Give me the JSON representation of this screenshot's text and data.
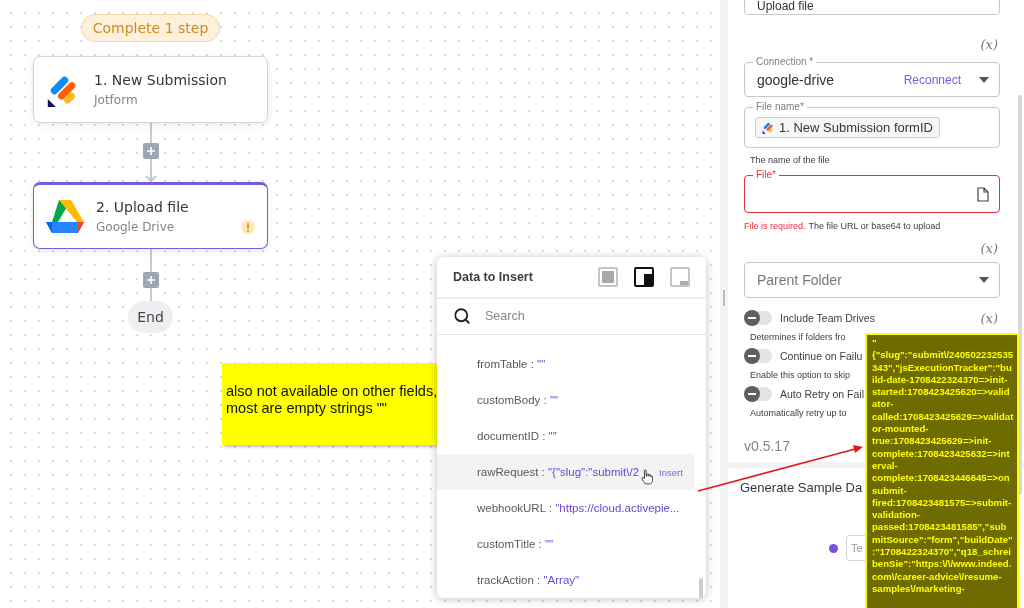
{
  "flow": {
    "status_badge": "Complete 1 step",
    "steps": [
      {
        "kind": "jotform",
        "title": "1. New Submission",
        "app": "Jotform",
        "selected": false,
        "warning": false
      },
      {
        "kind": "drive",
        "title": "2. Upload file",
        "app": "Google Drive",
        "selected": true,
        "warning": true
      }
    ],
    "end_label": "End"
  },
  "note": {
    "text": "also not available on other fields, most are empty strings \"\""
  },
  "data_popup": {
    "title": "Data to Insert",
    "view_buttons": [
      {
        "kind": "full",
        "selected": false
      },
      {
        "kind": "dock",
        "selected": true
      },
      {
        "kind": "mini",
        "selected": false
      }
    ],
    "search": {
      "placeholder": "Search"
    },
    "items": [
      {
        "key": "fromTable :",
        "value": "\"\"",
        "hovered": false
      },
      {
        "key": "customBody :",
        "value": "\"\"",
        "hovered": false
      },
      {
        "key": "documentID :",
        "value": "\"\"",
        "hovered": false
      },
      {
        "key": "rawRequest :",
        "value": "\"{\"slug\":\"submit\\/2",
        "hovered": true
      },
      {
        "key": "webhookURL :",
        "value": "\"https://cloud.activepie...",
        "hovered": false
      },
      {
        "key": "customTitle :",
        "value": "\"\"",
        "hovered": false
      },
      {
        "key": "trackAction :",
        "value": "\"Array\"",
        "hovered": false
      }
    ],
    "insert_label": "Insert"
  },
  "settings": {
    "step_name": "Upload file",
    "connection": {
      "label": "Connection *",
      "value": "google-drive",
      "action": "Reconnect",
      "dynamic": "(x)"
    },
    "file_name": {
      "label": "File name*",
      "chip": "1. New Submission formID",
      "help": "The name of the file"
    },
    "file": {
      "label": "File*",
      "invalid": true,
      "error": "File is required.",
      "help": "The file URL or base64 to upload"
    },
    "parent_folder": {
      "placeholder": "Parent Folder",
      "dynamic": "(x)"
    },
    "toggles": [
      {
        "label": "Include Team Drives",
        "on": false,
        "description": "Determines if folders fro",
        "dynamic": "(x)"
      },
      {
        "label": "Continue on Failu",
        "on": false,
        "description": "Enable this option to skip"
      },
      {
        "label": "Auto Retry on Fail",
        "on": false,
        "description": "Automatically retry up to"
      }
    ],
    "version": "v0.5.17",
    "sample": {
      "title": "Generate Sample Da",
      "input_placeholder": "Te"
    }
  },
  "tooltip": {
    "text": "\"{\"slug\":\"submit\\/240502232535343\",\"jsExecutionTracker\":\"build-date-1708422324370=>init-started:1708423425620=>validator-called:1708423425629=>validator-mounted-true:1708423425629=>init-complete:1708423425632=>interval-complete:1708423446645=>onsubmit-fired:1708423481575=>submit-validation-passed:1708423481585\",\"submitSource\":\"form\",\"buildDate\":\"1708422324370\",\"q18_schreibenSie\":\"https:\\/\\/www.indeed.com\\/career-advice\\/resume-samples\\/marketing-"
  }
}
